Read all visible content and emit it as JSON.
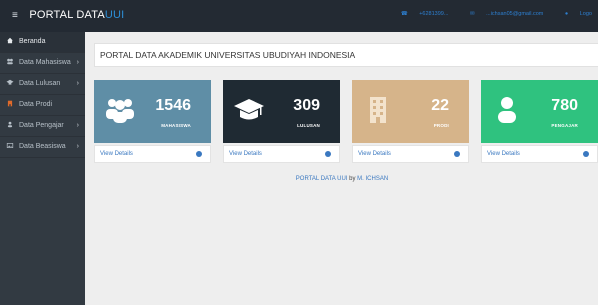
{
  "topbar": {
    "brand_main": "PORTAL DATA",
    "brand_highlight": "UUI",
    "menu_icon": "hamburger-icon",
    "phone": "+6281399...",
    "email": "...ichsan05@gmail.com",
    "logout": "Logo"
  },
  "sidebar": {
    "items": [
      {
        "label": "Beranda",
        "icon": "home-icon",
        "arrow": ""
      },
      {
        "label": "Data Mahasiswa",
        "icon": "users-icon",
        "arrow": "›"
      },
      {
        "label": "Data Lulusan",
        "icon": "graduation-cap-icon",
        "arrow": "›"
      },
      {
        "label": "Data Prodi",
        "icon": "building-icon",
        "arrow": ""
      },
      {
        "label": "Data Pengajar",
        "icon": "user-icon",
        "arrow": "›"
      },
      {
        "label": "Data Beasiswa",
        "icon": "image-icon",
        "arrow": "›"
      }
    ]
  },
  "header": {
    "title": "PORTAL DATA AKADEMIK UNIVERSITAS UBUDIYAH INDONESIA"
  },
  "cards": [
    {
      "value": "1546",
      "label": "MAHASISWA",
      "icon": "users-icon",
      "color": "#5f8ea6",
      "details": "View Details"
    },
    {
      "value": "309",
      "label": "LULUSAN",
      "icon": "graduation-cap-icon",
      "color": "#1f2a33",
      "details": "View Details"
    },
    {
      "value": "22",
      "label": "PRODI",
      "icon": "building-icon",
      "color": "#d6b48a",
      "details": "View Details"
    },
    {
      "value": "780",
      "label": "PENGAJAR",
      "icon": "user-icon",
      "color": "#2fc27f",
      "details": "View Details"
    }
  ],
  "footer": {
    "left": "PORTAL DATA UUI",
    "by": "by",
    "author": "M. ICHSAN"
  }
}
